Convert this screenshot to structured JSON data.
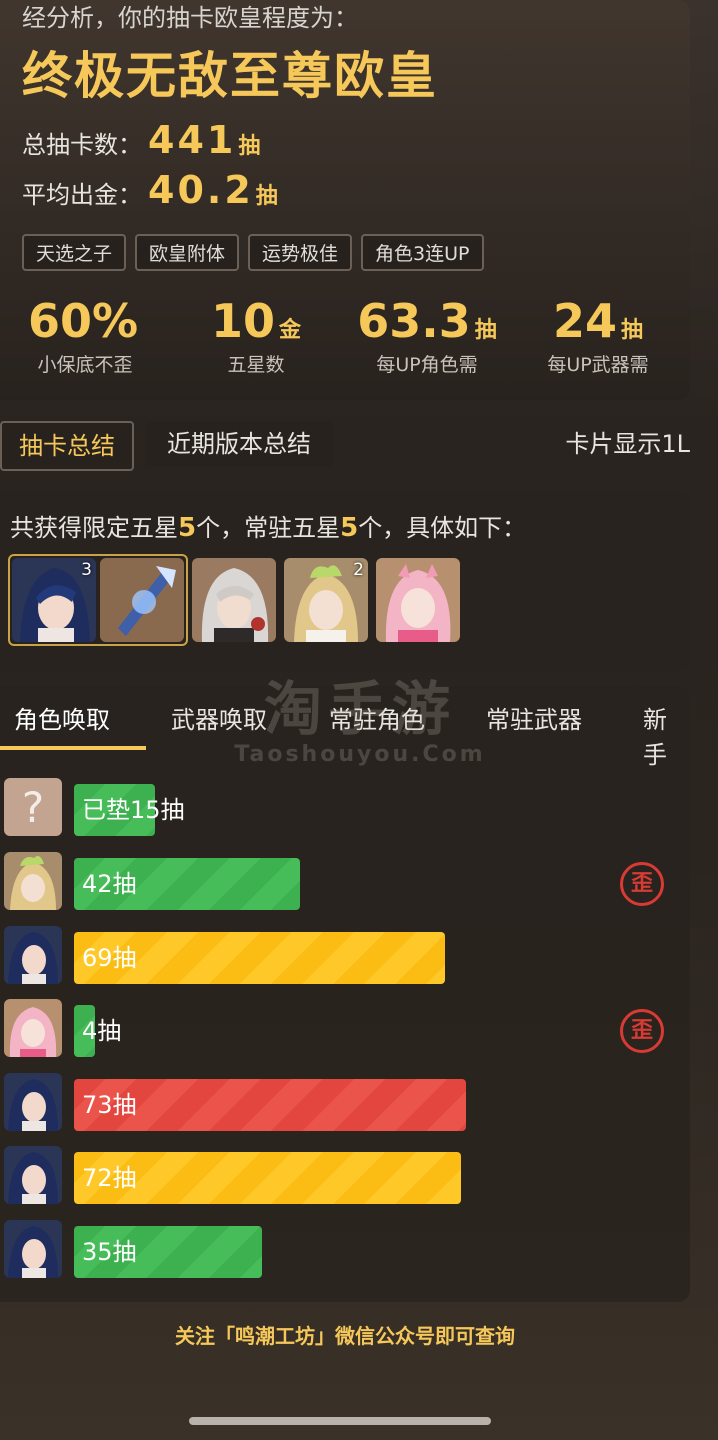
{
  "header": {
    "analysis_text": "经分析，你的抽卡欧皇程度为：",
    "level_title": "终极无敌至尊欧皇",
    "total_label": "总抽卡数：",
    "total_value": "441",
    "total_unit": "抽",
    "avg_label": "平均出金：",
    "avg_value": "40.2",
    "avg_unit": "抽",
    "tags": [
      "天选之子",
      "欧皇附体",
      "运势极佳",
      "角色3连UP"
    ]
  },
  "metrics": [
    {
      "value": "60%",
      "unit": "",
      "label": "小保底不歪"
    },
    {
      "value": "10",
      "unit": "金",
      "label": "五星数"
    },
    {
      "value": "63.3",
      "unit": "抽",
      "label": "每UP角色需"
    },
    {
      "value": "24",
      "unit": "抽",
      "label": "每UP武器需"
    }
  ],
  "summary_tabs": {
    "summary": "抽卡总结",
    "recent": "近期版本总结",
    "card_display": "卡片显示1L"
  },
  "obtained": {
    "prefix": "共获得限定五星",
    "limited_count": "5",
    "middle": "个，常驻五星",
    "standard_count": "5",
    "suffix": "个，具体如下：",
    "items": [
      {
        "name": "portrait-blue-hair-character",
        "count": "3",
        "selected": true
      },
      {
        "name": "portrait-weapon",
        "count": "",
        "selected": true
      },
      {
        "name": "portrait-white-hair-character",
        "count": ""
      },
      {
        "name": "portrait-green-hat-character",
        "count": "2"
      },
      {
        "name": "portrait-pink-hair-character",
        "count": ""
      }
    ]
  },
  "banner_tabs": [
    "角色唤取",
    "武器唤取",
    "常驻角色",
    "常驻武器",
    "新手"
  ],
  "pulls": [
    {
      "avatar": "unknown",
      "label": "已垫15抽",
      "pulls": 15,
      "color": "green",
      "lost_5050": false
    },
    {
      "avatar": "green-hat",
      "label": "42抽",
      "pulls": 42,
      "color": "green",
      "lost_5050": true
    },
    {
      "avatar": "blue-hair",
      "label": "69抽",
      "pulls": 69,
      "color": "yellow",
      "lost_5050": false
    },
    {
      "avatar": "pink-hair",
      "label": "4抽",
      "pulls": 4,
      "color": "green",
      "lost_5050": true
    },
    {
      "avatar": "blue-hair",
      "label": "73抽",
      "pulls": 73,
      "color": "red",
      "lost_5050": false
    },
    {
      "avatar": "blue-hair",
      "label": "72抽",
      "pulls": 72,
      "color": "yellow",
      "lost_5050": false
    },
    {
      "avatar": "blue-hair",
      "label": "35抽",
      "pulls": 35,
      "color": "green",
      "lost_5050": false
    }
  ],
  "stamp_text": "歪",
  "follow_note": "关注「鸣潮工坊」微信公众号即可查询",
  "watermark": {
    "main": "淘手游",
    "sub": "Taoshouyou.Com"
  }
}
